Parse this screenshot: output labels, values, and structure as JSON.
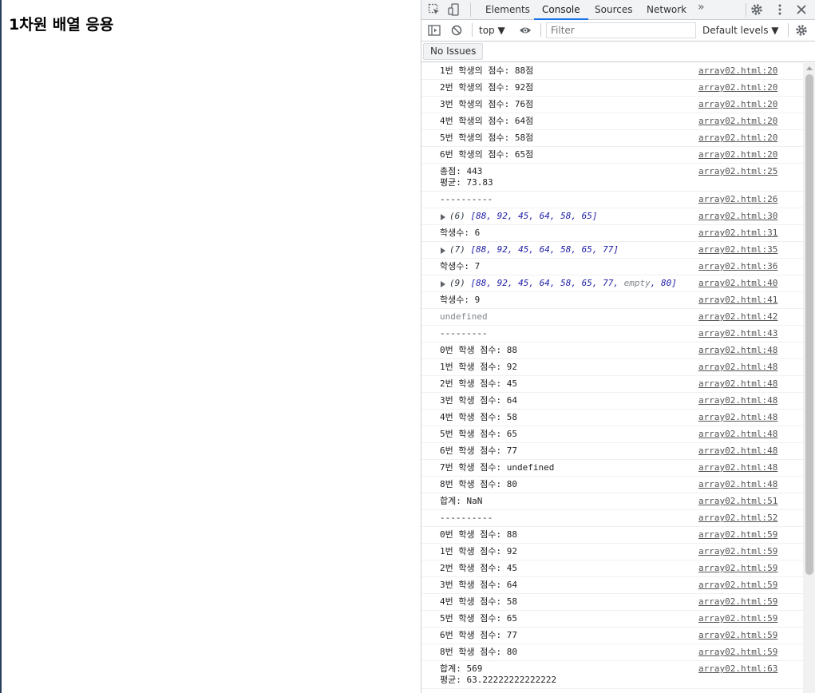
{
  "page": {
    "heading": "1차원 배열 응용"
  },
  "devtools": {
    "tabs": [
      "Elements",
      "Console",
      "Sources",
      "Network"
    ],
    "more_tabs": "»",
    "active_tab": "Console",
    "context": "top ▼",
    "filter_placeholder": "Filter",
    "levels": "Default levels ▼",
    "issues_button": "No Issues",
    "accent_color": "#1a73e8"
  },
  "console": {
    "messages": [
      {
        "text": "1번 학생의 점수: 88점",
        "source": "array02.html:20"
      },
      {
        "text": "2번 학생의 점수: 92점",
        "source": "array02.html:20"
      },
      {
        "text": "3번 학생의 점수: 76점",
        "source": "array02.html:20"
      },
      {
        "text": "4번 학생의 점수: 64점",
        "source": "array02.html:20"
      },
      {
        "text": "5번 학생의 점수: 58점",
        "source": "array02.html:20"
      },
      {
        "text": "6번 학생의 점수: 65점",
        "source": "array02.html:20"
      },
      {
        "text": "총점: 443\n평균: 73.83",
        "source": "array02.html:25"
      },
      {
        "text": "----------",
        "source": "array02.html:26"
      },
      {
        "type": "array",
        "count": "(6)",
        "items": [
          "88",
          "92",
          "45",
          "64",
          "58",
          "65"
        ],
        "source": "array02.html:30"
      },
      {
        "text": "학생수: 6",
        "source": "array02.html:31"
      },
      {
        "type": "array",
        "count": "(7)",
        "items": [
          "88",
          "92",
          "45",
          "64",
          "58",
          "65",
          "77"
        ],
        "source": "array02.html:35"
      },
      {
        "text": "학생수: 7",
        "source": "array02.html:36"
      },
      {
        "type": "array",
        "count": "(9)",
        "items": [
          "88",
          "92",
          "45",
          "64",
          "58",
          "65",
          "77",
          "empty",
          "80"
        ],
        "source": "array02.html:40"
      },
      {
        "text": "학생수: 9",
        "source": "array02.html:41"
      },
      {
        "text": "undefined",
        "style": "gray",
        "source": "array02.html:42"
      },
      {
        "text": "---------",
        "source": "array02.html:43"
      },
      {
        "text": "0번 학생 점수: 88",
        "source": "array02.html:48"
      },
      {
        "text": "1번 학생 점수: 92",
        "source": "array02.html:48"
      },
      {
        "text": "2번 학생 점수: 45",
        "source": "array02.html:48"
      },
      {
        "text": "3번 학생 점수: 64",
        "source": "array02.html:48"
      },
      {
        "text": "4번 학생 점수: 58",
        "source": "array02.html:48"
      },
      {
        "text": "5번 학생 점수: 65",
        "source": "array02.html:48"
      },
      {
        "text": "6번 학생 점수: 77",
        "source": "array02.html:48"
      },
      {
        "text": "7번 학생 점수: undefined",
        "source": "array02.html:48"
      },
      {
        "text": "8번 학생 점수: 80",
        "source": "array02.html:48"
      },
      {
        "text": "합계: NaN",
        "source": "array02.html:51"
      },
      {
        "text": "----------",
        "source": "array02.html:52"
      },
      {
        "text": "0번 학생 점수: 88",
        "source": "array02.html:59"
      },
      {
        "text": "1번 학생 점수: 92",
        "source": "array02.html:59"
      },
      {
        "text": "2번 학생 점수: 45",
        "source": "array02.html:59"
      },
      {
        "text": "3번 학생 점수: 64",
        "source": "array02.html:59"
      },
      {
        "text": "4번 학생 점수: 58",
        "source": "array02.html:59"
      },
      {
        "text": "5번 학생 점수: 65",
        "source": "array02.html:59"
      },
      {
        "text": "6번 학생 점수: 77",
        "source": "array02.html:59"
      },
      {
        "text": "8번 학생 점수: 80",
        "source": "array02.html:59"
      },
      {
        "text": "합계: 569\n평균: 63.22222222222222",
        "source": "array02.html:63"
      },
      {
        "text": "----------",
        "source": "array02.html:64"
      }
    ]
  }
}
